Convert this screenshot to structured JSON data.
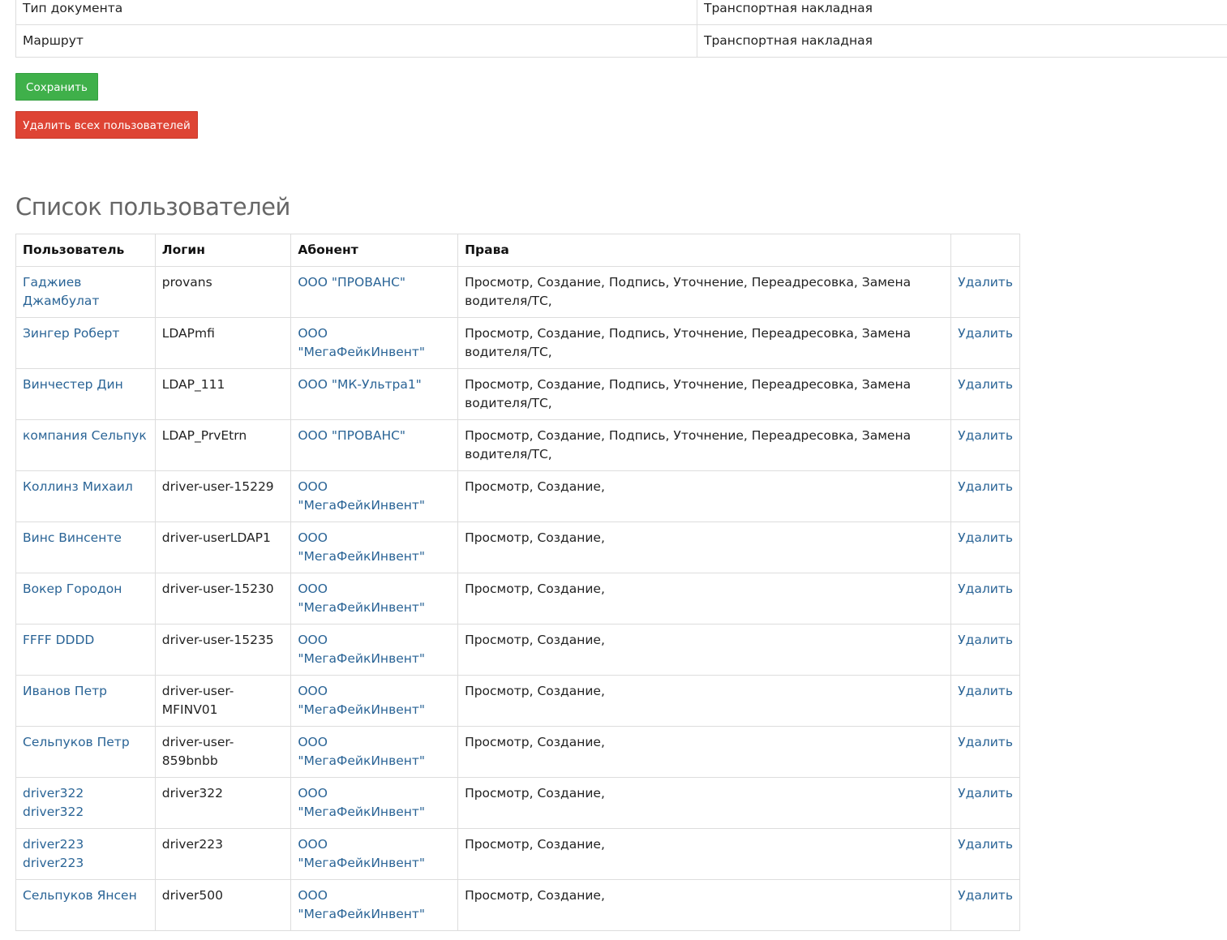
{
  "doc_props": [
    {
      "key": "Тип документа",
      "value": "Транспортная накладная"
    },
    {
      "key": "Маршрут",
      "value": "Транспортная накладная"
    }
  ],
  "buttons": {
    "save": "Сохранить",
    "delete_all": "Удалить всех пользователей"
  },
  "colors": {
    "save": "#3fb04a",
    "danger": "#de4434",
    "link": "#2a6496"
  },
  "users_section": {
    "title": "Список пользователей",
    "headers": [
      "Пользователь",
      "Логин",
      "Абонент",
      "Права",
      ""
    ],
    "rows": [
      {
        "user": "Гаджиев Джамбулат",
        "login": "provans",
        "subscriber": "ООО \"ПРОВАНС\"",
        "rights": "Просмотр, Создание, Подпись, Уточнение, Переадресовка, Замена водителя/ТС,",
        "action": "Удалить"
      },
      {
        "user": "Зингер Роберт",
        "login": "LDAPmfi",
        "subscriber": "ООО \"МегаФейкИнвент\"",
        "rights": "Просмотр, Создание, Подпись, Уточнение, Переадресовка, Замена водителя/ТС,",
        "action": "Удалить"
      },
      {
        "user": "Винчестер Дин",
        "login": "LDAP_111",
        "subscriber": "ООО \"МК-Ультра1\"",
        "rights": "Просмотр, Создание, Подпись, Уточнение, Переадресовка, Замена водителя/ТС,",
        "action": "Удалить"
      },
      {
        "user": "компания Сельпук",
        "login": "LDAP_PrvEtrn",
        "subscriber": "ООО \"ПРОВАНС\"",
        "rights": "Просмотр, Создание, Подпись, Уточнение, Переадресовка, Замена водителя/ТС,",
        "action": "Удалить"
      },
      {
        "user": "Коллинз Михаил",
        "login": "driver-user-15229",
        "subscriber": "ООО \"МегаФейкИнвент\"",
        "rights": "Просмотр, Создание,",
        "action": "Удалить"
      },
      {
        "user": "Винс Винсенте",
        "login": "driver-userLDAP1",
        "subscriber": "ООО \"МегаФейкИнвент\"",
        "rights": "Просмотр, Создание,",
        "action": "Удалить"
      },
      {
        "user": "Вокер Городон",
        "login": "driver-user-15230",
        "subscriber": "ООО \"МегаФейкИнвент\"",
        "rights": "Просмотр, Создание,",
        "action": "Удалить"
      },
      {
        "user": "FFFF DDDD",
        "login": "driver-user-15235",
        "subscriber": "ООО \"МегаФейкИнвент\"",
        "rights": "Просмотр, Создание,",
        "action": "Удалить"
      },
      {
        "user": "Иванов Петр",
        "login": "driver-user-MFINV01",
        "subscriber": "ООО \"МегаФейкИнвент\"",
        "rights": "Просмотр, Создание,",
        "action": "Удалить"
      },
      {
        "user": "Сельпуков Петр",
        "login": "driver-user-859bnbb",
        "subscriber": "ООО \"МегаФейкИнвент\"",
        "rights": "Просмотр, Создание,",
        "action": "Удалить"
      },
      {
        "user": "driver322 driver322",
        "login": "driver322",
        "subscriber": "ООО \"МегаФейкИнвент\"",
        "rights": "Просмотр, Создание,",
        "action": "Удалить"
      },
      {
        "user": "driver223 driver223",
        "login": "driver223",
        "subscriber": "ООО \"МегаФейкИнвент\"",
        "rights": "Просмотр, Создание,",
        "action": "Удалить"
      },
      {
        "user": "Сельпуков Янсен",
        "login": "driver500",
        "subscriber": "ООО \"МегаФейкИнвент\"",
        "rights": "Просмотр, Создание,",
        "action": "Удалить"
      }
    ]
  }
}
